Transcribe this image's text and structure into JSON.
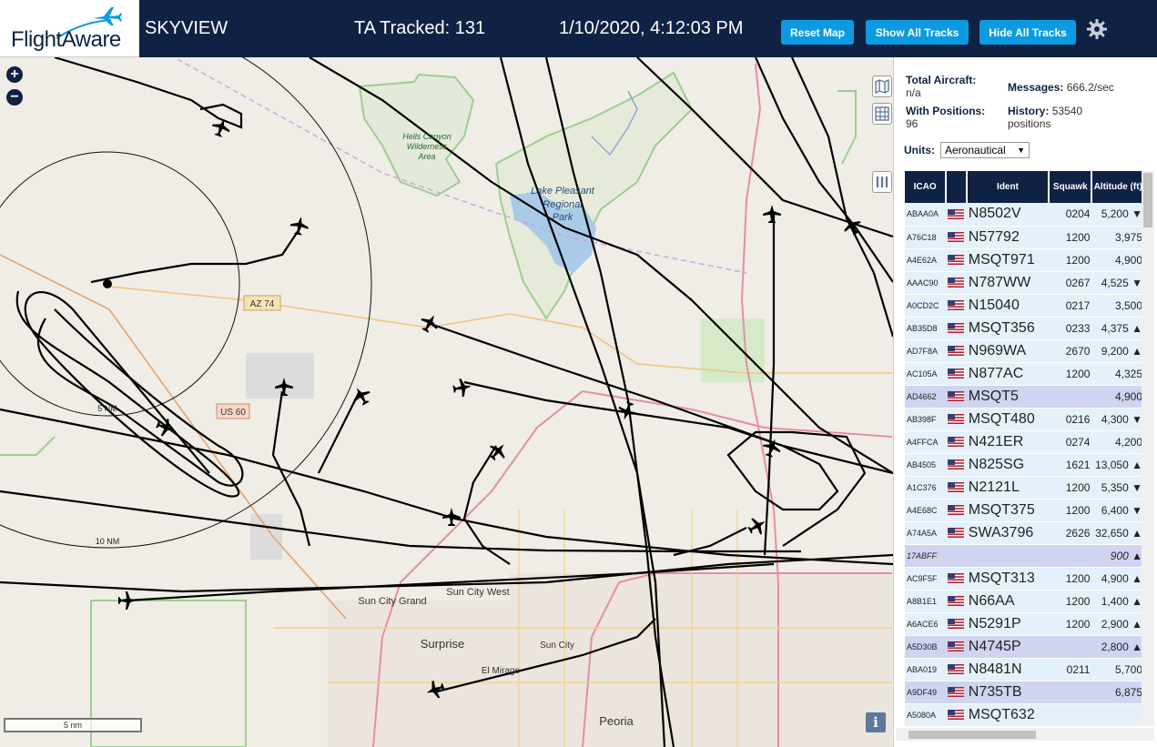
{
  "brand": {
    "logo_text": "FlightAware"
  },
  "header": {
    "site_name": "SKYVIEW",
    "tracked_text": "TA Tracked: 131",
    "clock": "1/10/2020, 4:12:03 PM",
    "buttons": {
      "reset": "Reset Map",
      "show": "Show All Tracks",
      "hide": "Hide All Tracks"
    }
  },
  "map": {
    "labels": {
      "hells_canyon": "Hells Canyon",
      "wilderness": "Wilderness",
      "area": "Area",
      "lake_pleasant": "Lake Pleasant",
      "regional": "Regional",
      "park": "Park",
      "az74": "AZ 74",
      "us60": "US 60",
      "ring5": "5 NM",
      "ring10": "10 NM",
      "sun_city_grand": "Sun City Grand",
      "sun_city_west": "Sun City West",
      "surprise": "Surprise",
      "sun_city": "Sun City",
      "el_mirage": "El Mirage",
      "peoria": "Peoria"
    },
    "scale": "5 nm",
    "info": "i",
    "zoom_in": "+",
    "zoom_out": "−"
  },
  "stats": {
    "total_label": "Total Aircraft:",
    "total_value": "n/a",
    "positions_label": "With Positions:",
    "positions_value": "96",
    "messages_label": "Messages:",
    "messages_value": "666.2/sec",
    "history_label": "History:",
    "history_value": "53540",
    "history_unit": "positions"
  },
  "units": {
    "label": "Units:",
    "selected": "Aeronautical"
  },
  "table": {
    "headers": {
      "icao": "ICAO",
      "ident": "Ident",
      "squawk": "Squawk",
      "altitude": "Altitude (ft)"
    },
    "rows": [
      {
        "icao": "ABAA0A",
        "ident": "N8502V",
        "squawk": "0204",
        "alt": "5,200 ▼"
      },
      {
        "icao": "A76C18",
        "ident": "N57792",
        "squawk": "1200",
        "alt": "3,975"
      },
      {
        "icao": "A4E62A",
        "ident": "MSQT971",
        "squawk": "1200",
        "alt": "4,900"
      },
      {
        "icao": "AAAC90",
        "ident": "N787WW",
        "squawk": "0267",
        "alt": "4,525 ▼"
      },
      {
        "icao": "A0CD2C",
        "ident": "N15040",
        "squawk": "0217",
        "alt": "3,500"
      },
      {
        "icao": "AB35D8",
        "ident": "MSQT356",
        "squawk": "0233",
        "alt": "4,375 ▲"
      },
      {
        "icao": "AD7F8A",
        "ident": "N969WA",
        "squawk": "2670",
        "alt": "9,200 ▲"
      },
      {
        "icao": "AC105A",
        "ident": "N877AC",
        "squawk": "1200",
        "alt": "4,325"
      },
      {
        "icao": "AD4662",
        "ident": "MSQT5",
        "squawk": "",
        "alt": "4,900"
      },
      {
        "icao": "AB398F",
        "ident": "MSQT480",
        "squawk": "0216",
        "alt": "4,300 ▼"
      },
      {
        "icao": "A4FFCA",
        "ident": "N421ER",
        "squawk": "0274",
        "alt": "4,200"
      },
      {
        "icao": "AB4505",
        "ident": "N825SG",
        "squawk": "1621",
        "alt": "13,050 ▲"
      },
      {
        "icao": "A1C376",
        "ident": "N2121L",
        "squawk": "1200",
        "alt": "5,350 ▼"
      },
      {
        "icao": "A4E68C",
        "ident": "MSQT375",
        "squawk": "1200",
        "alt": "6,400 ▼"
      },
      {
        "icao": "A74A5A",
        "ident": "SWA3796",
        "squawk": "2626",
        "alt": "32,650 ▲"
      },
      {
        "icao": "17ABFF",
        "ident": "",
        "squawk": "",
        "alt": "900 ▲"
      },
      {
        "icao": "AC9F5F",
        "ident": "MSQT313",
        "squawk": "1200",
        "alt": "4,900 ▲"
      },
      {
        "icao": "A8B1E1",
        "ident": "N66AA",
        "squawk": "1200",
        "alt": "1,400 ▲"
      },
      {
        "icao": "A6ACE6",
        "ident": "N5291P",
        "squawk": "1200",
        "alt": "2,900 ▲"
      },
      {
        "icao": "A5D30B",
        "ident": "N4745P",
        "squawk": "",
        "alt": "2,800 ▲"
      },
      {
        "icao": "ABA019",
        "ident": "N8481N",
        "squawk": "0211",
        "alt": "5,700"
      },
      {
        "icao": "A9DF49",
        "ident": "N735TB",
        "squawk": "",
        "alt": "6,875"
      },
      {
        "icao": "A5080A",
        "ident": "MSQT632",
        "squawk": "",
        "alt": ""
      }
    ],
    "selected_rows": [
      "AD4662",
      "17ABFF",
      "A5D30B",
      "A9DF49"
    ],
    "italic_rows": [
      "17ABFF"
    ]
  }
}
